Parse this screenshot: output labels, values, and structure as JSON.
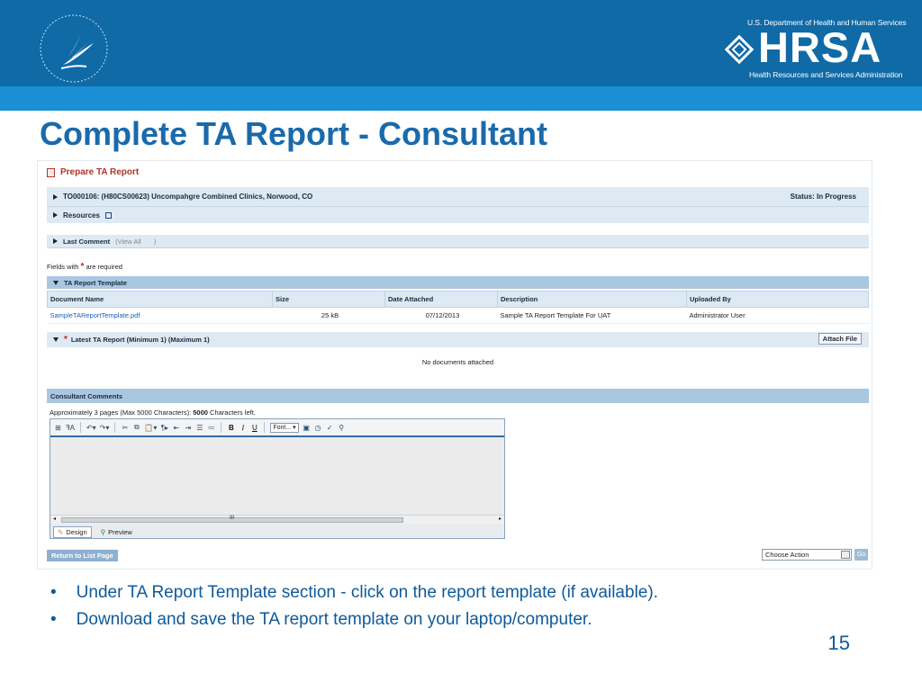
{
  "banner": {
    "agency_top": "U.S. Department of Health and Human Services",
    "brand": "HRSA",
    "agency_bottom": "Health Resources and Services Administration"
  },
  "slide": {
    "title": "Complete TA Report - Consultant",
    "bullets": [
      "Under TA Report Template section - click on the report template (if available).",
      "Download and save the TA report template on your laptop/computer."
    ],
    "page_number": "15"
  },
  "app": {
    "page_title": "Prepare TA Report",
    "task_line": "TO000106: (H80CS00623) Uncompahgre Combined Clinics, Norwood, CO",
    "status": "Status: In Progress",
    "resources": "Resources",
    "last_comment": "Last Comment",
    "view_all": "(View All",
    "view_all_close": ")",
    "required_prefix": "Fields with",
    "required_suffix": "are required",
    "template_section": {
      "title": "TA Report Template",
      "columns": [
        "Document Name",
        "Size",
        "Date Attached",
        "Description",
        "Uploaded By"
      ],
      "rows": [
        [
          "SampleTAReportTemplate.pdf",
          "25 kB",
          "07/12/2013",
          "Sample TA Report Template For UAT",
          "Administrator User"
        ]
      ]
    },
    "latest_section": {
      "title": "Latest TA Report (Minimum 1) (Maximum 1)",
      "attach_label": "Attach File",
      "empty_text": "No documents attached"
    },
    "comments_section": {
      "title": "Consultant Comments",
      "approx_prefix": "Approximately 3 pages (Max 5000 Characters): ",
      "approx_count": "5000",
      "approx_suffix": " Characters left."
    },
    "editor": {
      "font_label": "Font...",
      "design_label": "Design",
      "preview_label": "Preview",
      "scroll_grip": "III"
    },
    "footer": {
      "return_label": "Return to List Page",
      "action_value": "Choose Action",
      "go_label": "Go"
    }
  },
  "colors": {
    "banner": "#0f6aa6",
    "stripe": "#1a8fd4",
    "title": "#1a6aab",
    "section_header": "#aac7e2",
    "required_star": "#d6201b"
  }
}
